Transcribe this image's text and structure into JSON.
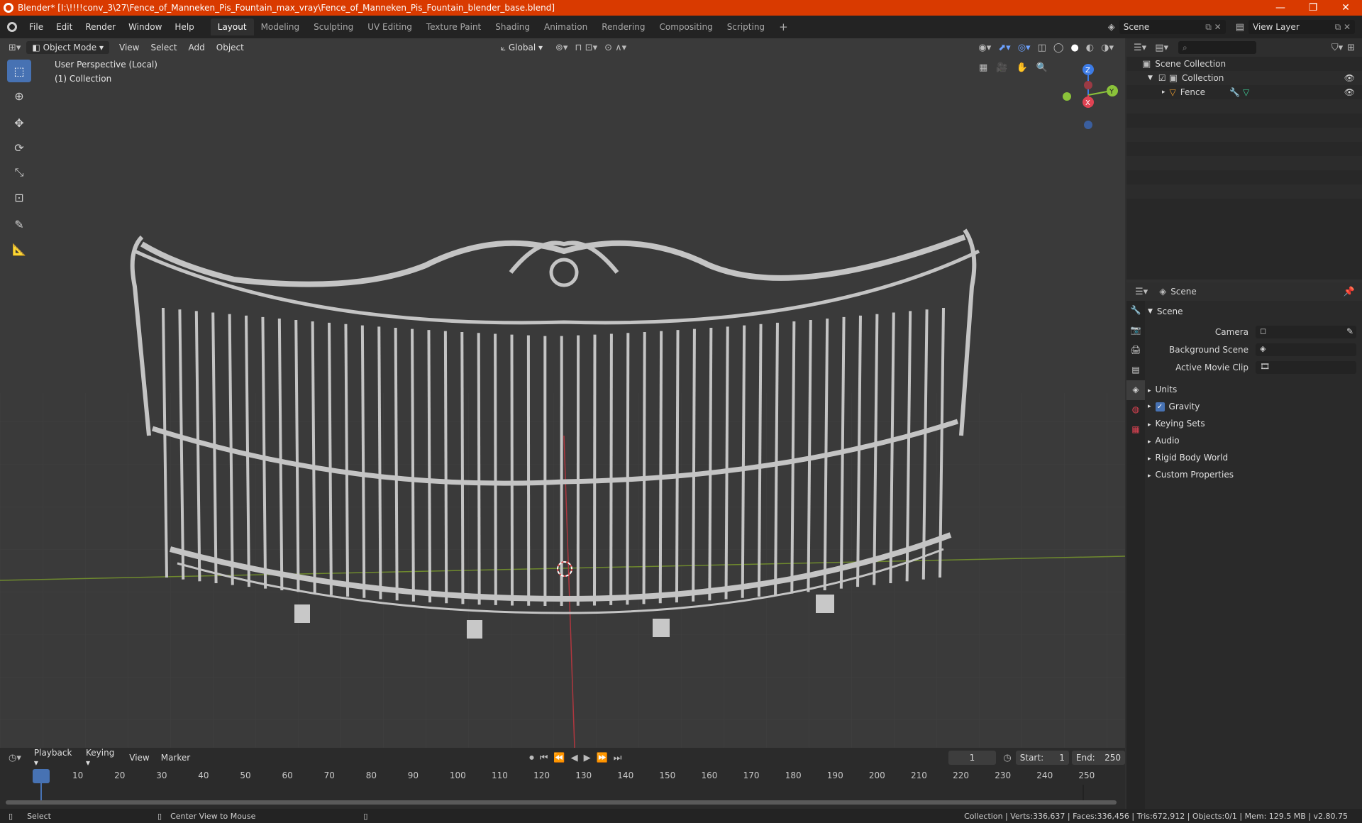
{
  "window": {
    "title": "Blender* [I:\\!!!!conv_3\\27\\Fence_of_Manneken_Pis_Fountain_max_vray\\Fence_of_Manneken_Pis_Fountain_blender_base.blend]",
    "controls": [
      "—",
      "❐",
      "✕"
    ]
  },
  "menu": {
    "items": [
      "File",
      "Edit",
      "Render",
      "Window",
      "Help"
    ],
    "workspaces": [
      "Layout",
      "Modeling",
      "Sculpting",
      "UV Editing",
      "Texture Paint",
      "Shading",
      "Animation",
      "Rendering",
      "Compositing",
      "Scripting"
    ],
    "active_workspace": "Layout",
    "add_tab": "+",
    "scene": "Scene",
    "view_layer": "View Layer"
  },
  "viewport": {
    "mode": "Object Mode",
    "menus": [
      "View",
      "Select",
      "Add",
      "Object"
    ],
    "transform_orientation": "Global",
    "perspective_label": "User Perspective (Local)",
    "collection_label": "(1) Collection",
    "gizmo": {
      "z": "Z",
      "y": "Y",
      "x": "X"
    }
  },
  "outliner": {
    "root": "Scene Collection",
    "collection": "Collection",
    "object": "Fence"
  },
  "properties": {
    "context": "Scene",
    "section": "Scene",
    "rows": [
      {
        "label": "Camera"
      },
      {
        "label": "Background Scene"
      },
      {
        "label": "Active Movie Clip"
      }
    ],
    "panels": [
      "Units",
      "Gravity",
      "Keying Sets",
      "Audio",
      "Rigid Body World",
      "Custom Properties"
    ],
    "gravity_enabled": true
  },
  "timeline": {
    "menus": [
      "Playback",
      "Keying",
      "View",
      "Marker"
    ],
    "current_frame": "1",
    "start_label": "Start:",
    "start": "1",
    "end_label": "End:",
    "end": "250",
    "ticks": [
      "1",
      "10",
      "20",
      "30",
      "40",
      "50",
      "60",
      "70",
      "80",
      "90",
      "100",
      "110",
      "120",
      "130",
      "140",
      "150",
      "160",
      "170",
      "180",
      "190",
      "200",
      "210",
      "220",
      "230",
      "240",
      "250"
    ]
  },
  "status": {
    "left": "Select",
    "middle": "Center View to Mouse",
    "right": "Collection | Verts:336,637 | Faces:336,456 | Tris:672,912 | Objects:0/1 | Mem: 129.5 MB | v2.80.75"
  },
  "colors": {
    "titlebar": "#d93a00",
    "accent": "#4772b3",
    "axis_x": "#e04353",
    "axis_y": "#8bc33a",
    "axis_z": "#3c7be6",
    "fence": "#bdbdbd"
  }
}
